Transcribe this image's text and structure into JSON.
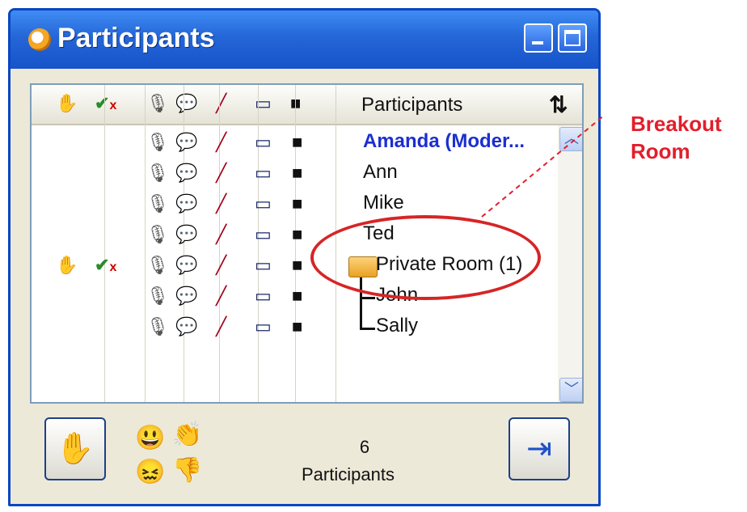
{
  "window": {
    "title": "Participants"
  },
  "list": {
    "header_label": "Participants",
    "rows": [
      {
        "name": "Amanda (Moder...",
        "type": "moderator"
      },
      {
        "name": "Ann",
        "type": "user"
      },
      {
        "name": "Mike",
        "type": "user"
      },
      {
        "name": "Ted",
        "type": "user"
      },
      {
        "name": "Private Room (1)",
        "type": "room"
      },
      {
        "name": "John",
        "type": "child"
      },
      {
        "name": "Sally",
        "type": "child"
      }
    ]
  },
  "footer": {
    "count": "6",
    "count_label": "Participants"
  },
  "annotation": {
    "line1": "Breakout",
    "line2": "Room"
  },
  "icons": [
    "hand-icon",
    "check-x-icon",
    "mic-icon",
    "chat-icon",
    "pen-icon",
    "screen-icon",
    "camera-icon",
    "sort-icon",
    "folder-icon",
    "smile-icon",
    "applause-icon",
    "sad-icon",
    "thumbs-down-icon",
    "raise-hand-icon",
    "exit-icon"
  ],
  "colors": {
    "titlebar": "#2466d8",
    "moderator": "#1c2fd0",
    "annotation": "#e31e2b"
  }
}
